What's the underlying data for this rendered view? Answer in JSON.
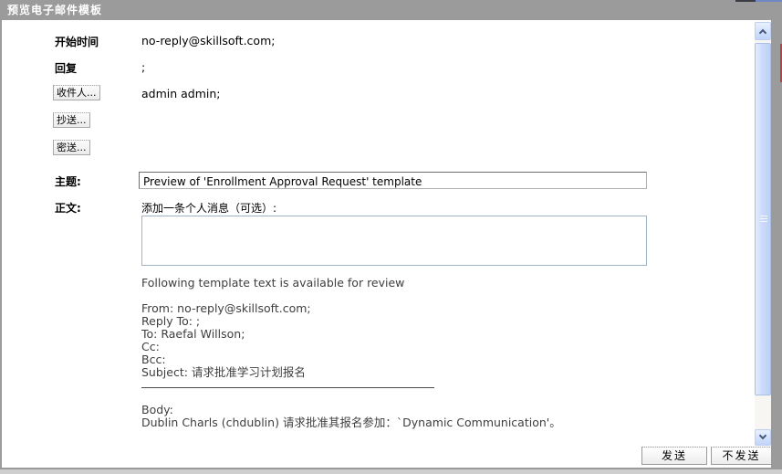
{
  "title": "预览电子邮件模板",
  "form": {
    "rows": [
      {
        "label": "开始时间",
        "value": "no-reply@skillsoft.com;"
      },
      {
        "label": "回复",
        "value": ";"
      }
    ],
    "to_button": "收件人...",
    "to_value": "admin admin;",
    "cc_button": "抄送...",
    "bcc_button": "密送...",
    "subject_label": "主题:",
    "subject_value": "Preview of 'Enrollment Approval Request' template",
    "body_label": "正文:",
    "personal_message_label": "添加一条个人消息（可选）:",
    "personal_message_value": ""
  },
  "preview": {
    "intro": "Following template text is available for review",
    "lines": [
      "From: no-reply@skillsoft.com;",
      "Reply To: ;",
      "To: Raefal Willson;",
      "Cc:",
      "Bcc:",
      "Subject: 请求批准学习计划报名"
    ],
    "body_label": "Body:",
    "body_text": "Dublin Charls (chdublin) 请求批准其报名参加：`Dynamic Communication'。"
  },
  "footer": {
    "send_label": "发送",
    "no_send_label": "不发送"
  },
  "colors": {
    "titlebar": "#9b9b9b",
    "scroll_accent": "#c8d9f9",
    "preview_text": "#3e3e3e"
  }
}
